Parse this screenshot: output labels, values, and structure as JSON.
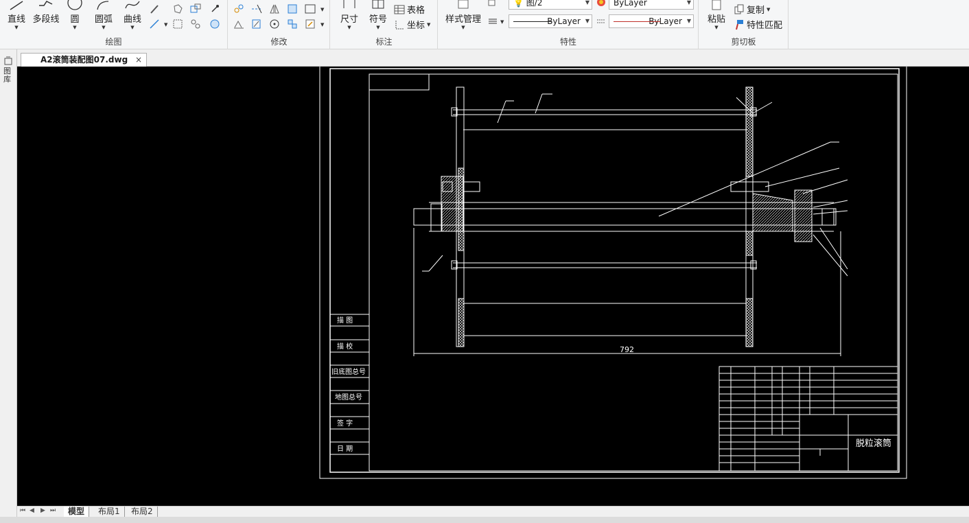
{
  "ribbon": {
    "draw": {
      "label": "绘图",
      "line": "直线",
      "polyline": "多段线",
      "circle": "圆",
      "arc": "圆弧",
      "curve": "曲线"
    },
    "modify": {
      "label": "修改"
    },
    "annotate": {
      "label": "标注",
      "dimension": "尺寸",
      "symbol": "符号",
      "table": "表格",
      "coordinate": "坐标"
    },
    "properties": {
      "label": "特性",
      "style_manager": "样式管理",
      "layer_value": "ByLayer",
      "linetype_value": "ByLayer",
      "color_value": "ByLayer",
      "layer_name": "图/2"
    },
    "clipboard": {
      "label": "剪切板",
      "paste": "粘贴",
      "copy": "复制",
      "match_props": "特性匹配"
    }
  },
  "document_tab": {
    "title": "A2滚筒装配图07.dwg",
    "close": "×"
  },
  "side_panel": {
    "label": "图库"
  },
  "drawing": {
    "dimension_text": "792",
    "title_text": "脱粒滚筒",
    "left_table": [
      "描 图",
      "描 校",
      "旧底图总号",
      "地图总号",
      "签 字",
      "日 期"
    ],
    "colors": {
      "background": "#000000",
      "lines": "#ffffff"
    }
  },
  "layout_tabs": [
    "模型",
    "布局1",
    "布局2"
  ],
  "active_layout": "模型"
}
